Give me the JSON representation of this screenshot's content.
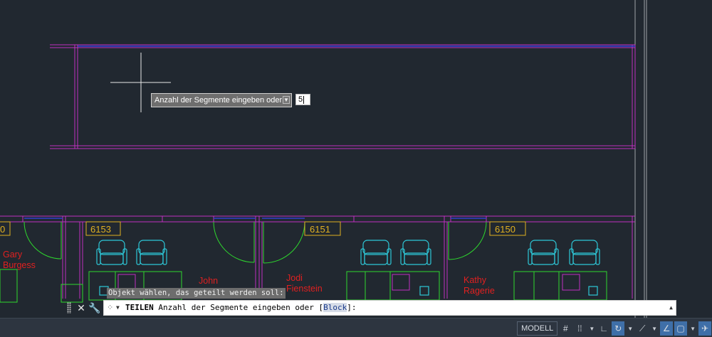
{
  "drawing": {
    "rooms": [
      {
        "number": "6153"
      },
      {
        "number": "6151"
      },
      {
        "number": "6150"
      }
    ],
    "occupants": [
      {
        "line1": "Gary",
        "line2": "Burgess"
      },
      {
        "line1": "John",
        "line2": ""
      },
      {
        "line1": "Jodi",
        "line2": "Fienstein"
      },
      {
        "line1": "Kathy",
        "line2": "Ragerie"
      }
    ],
    "room_partial": "0"
  },
  "dynamic_input": {
    "prompt": "Anzahl der Segmente eingeben oder",
    "value": "5"
  },
  "command_history": "Objekt wählen, das geteilt werden soll:",
  "command_line": {
    "command": "TEILEN",
    "prompt": "Anzahl der Segmente eingeben oder [",
    "option": "Block",
    "suffix": "]:"
  },
  "status_bar": {
    "model_label": "MODELL"
  },
  "colors": {
    "background": "#212830",
    "walls": "#c031c0",
    "doors": "#2ed82e",
    "furniture": "#2ec8d8",
    "room_tags": "#e0b020",
    "names": "#e02020",
    "windows": "#3040d0"
  }
}
